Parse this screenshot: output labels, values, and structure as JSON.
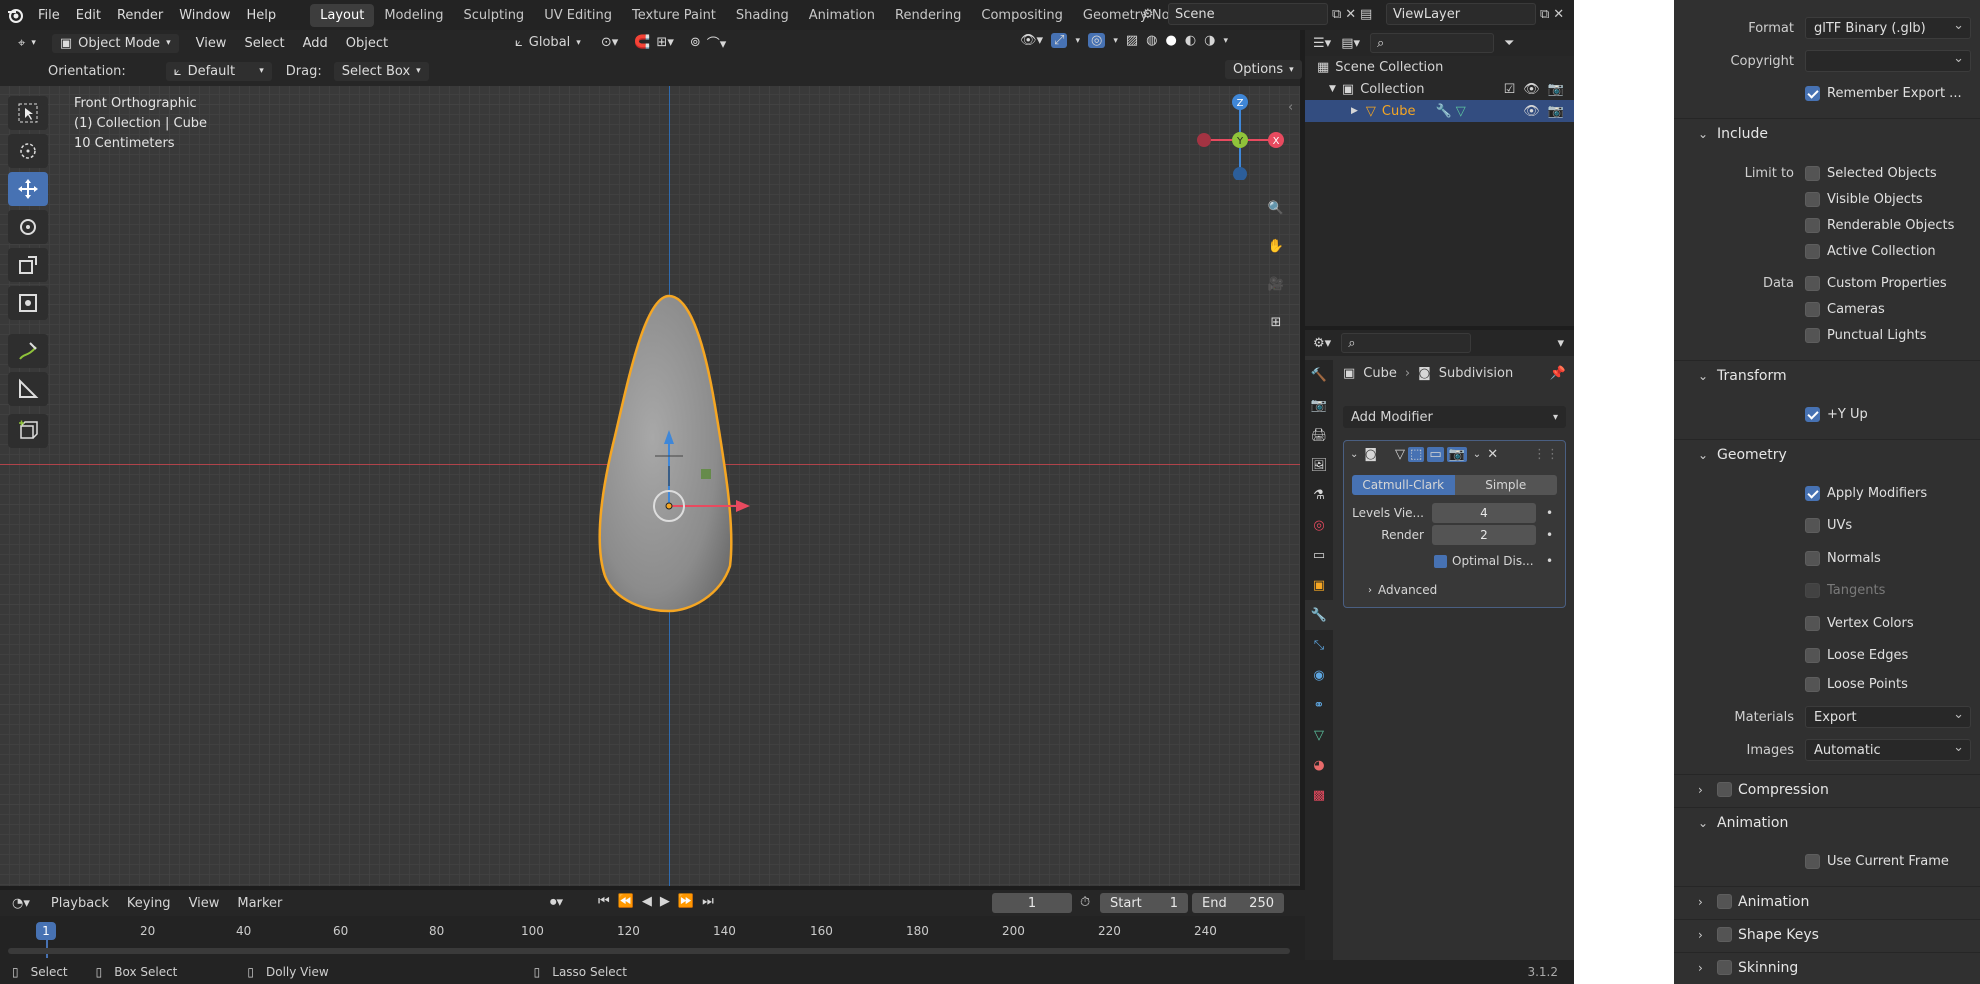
{
  "menu": [
    "File",
    "Edit",
    "Render",
    "Window",
    "Help"
  ],
  "workspaces": [
    "Layout",
    "Modeling",
    "Sculpting",
    "UV Editing",
    "Texture Paint",
    "Shading",
    "Animation",
    "Rendering",
    "Compositing",
    "Geometry Nodes"
  ],
  "scene": "Scene",
  "viewlayer": "ViewLayer",
  "viewport_header": {
    "mode": "Object Mode",
    "menus": [
      "View",
      "Select",
      "Add",
      "Object"
    ],
    "orientation_global": "Global"
  },
  "tool_header": {
    "orientation_label": "Orientation:",
    "orientation_value": "Default",
    "drag_label": "Drag:",
    "drag_value": "Select Box",
    "options": "Options"
  },
  "overlay": {
    "view_name": "Front Orthographic",
    "collection": "(1) Collection | Cube",
    "scale": "10 Centimeters"
  },
  "gizmo": {
    "z": "Z",
    "y": "Y",
    "x": "X"
  },
  "outliner": {
    "scene_collection": "Scene Collection",
    "collection": "Collection",
    "object": "Cube"
  },
  "properties": {
    "breadcrumb_object": "Cube",
    "breadcrumb_modifier": "Subdivision",
    "add_modifier": "Add Modifier",
    "catmull": "Catmull-Clark",
    "simple": "Simple",
    "levels_label": "Levels Vie...",
    "levels_value": "4",
    "render_label": "Render",
    "render_value": "2",
    "optimal": "Optimal Dis...",
    "advanced": "Advanced"
  },
  "timeline": {
    "menus": [
      "Playback",
      "Keying",
      "View",
      "Marker"
    ],
    "current_frame": "1",
    "start_label": "Start",
    "start_value": "1",
    "end_label": "End",
    "end_value": "250",
    "ticks": [
      "20",
      "40",
      "60",
      "80",
      "100",
      "120",
      "140",
      "160",
      "180",
      "200",
      "220",
      "240"
    ],
    "playhead": "1"
  },
  "status": {
    "select": "Select",
    "box_select": "Box Select",
    "dolly": "Dolly View",
    "lasso": "Lasso Select",
    "version": "3.1.2"
  },
  "export": {
    "format_label": "Format",
    "format_value": "glTF Binary (.glb)",
    "copyright_label": "Copyright",
    "copyright_value": "",
    "remember": "Remember Export ...",
    "include": "Include",
    "limit_label": "Limit to",
    "selected_objects": "Selected Objects",
    "visible_objects": "Visible Objects",
    "renderable_objects": "Renderable Objects",
    "active_collection": "Active Collection",
    "data_label": "Data",
    "custom_properties": "Custom Properties",
    "cameras": "Cameras",
    "punctual_lights": "Punctual Lights",
    "transform": "Transform",
    "y_up": "+Y Up",
    "geometry": "Geometry",
    "apply_modifiers": "Apply Modifiers",
    "uvs": "UVs",
    "normals": "Normals",
    "tangents": "Tangents",
    "vertex_colors": "Vertex Colors",
    "loose_edges": "Loose Edges",
    "loose_points": "Loose Points",
    "materials_label": "Materials",
    "materials_value": "Export",
    "images_label": "Images",
    "images_value": "Automatic",
    "compression": "Compression",
    "animation_section": "Animation",
    "use_current_frame": "Use Current Frame",
    "animation_sub": "Animation",
    "shape_keys": "Shape Keys",
    "skinning": "Skinning"
  },
  "colors": {
    "accent": "#4772b3",
    "selection_orange": "#f5a623",
    "x_red": "#e84a5f",
    "y_green": "#8fc33a",
    "z_blue": "#3f87d8"
  }
}
